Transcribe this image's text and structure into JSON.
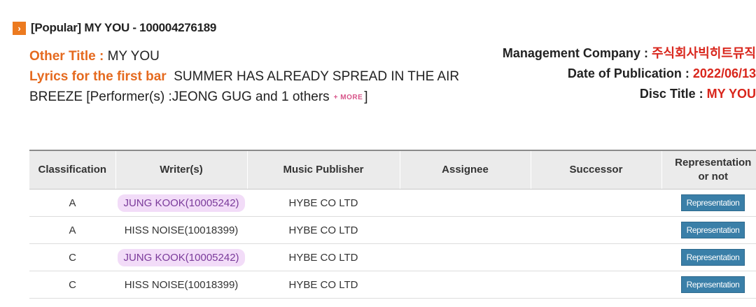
{
  "header": {
    "icon": "chevron-right-icon",
    "title": "[Popular] MY YOU - 100004276189"
  },
  "info": {
    "other_title_label": "Other Title :",
    "other_title_value": "MY YOU",
    "lyrics_label": "Lyrics for the first bar",
    "lyrics_line1": "SUMMER HAS ALREADY SPREAD IN THE AIR",
    "lyrics_line2": "BREEZE [Performer(s) :JEONG GUG and 1 others",
    "more_label": "+ MORE",
    "close_bracket": "]",
    "management_label": "Management Company :",
    "management_value": "주식회사빅히트뮤직",
    "date_label": "Date of Publication :",
    "date_value": "2022/06/13",
    "disc_label": "Disc Title :",
    "disc_value": "MY YOU"
  },
  "table": {
    "headers": {
      "classification": "Classification",
      "writers": "Writer(s)",
      "publisher": "Music Publisher",
      "assignee": "Assignee",
      "successor": "Successor",
      "representation_1": "Representation",
      "representation_2": "or not"
    },
    "rows": [
      {
        "classification": "A",
        "writer": "JUNG KOOK(10005242)",
        "publisher": "HYBE CO LTD",
        "assignee": "",
        "successor": "",
        "representation": "Representation"
      },
      {
        "classification": "A",
        "writer": "HISS NOISE(10018399)",
        "publisher": "HYBE CO LTD",
        "assignee": "",
        "successor": "",
        "representation": "Representation"
      },
      {
        "classification": "C",
        "writer": "JUNG KOOK(10005242)",
        "publisher": "HYBE CO LTD",
        "assignee": "",
        "successor": "",
        "representation": "Representation"
      },
      {
        "classification": "C",
        "writer": "HISS NOISE(10018399)",
        "publisher": "HYBE CO LTD",
        "assignee": "",
        "successor": "",
        "representation": "Representation"
      }
    ]
  },
  "colors": {
    "accent_orange": "#e56a1f",
    "value_red": "#d9261c",
    "button_blue": "#3a7fa8",
    "highlight_purple": "#e2b2f0"
  }
}
